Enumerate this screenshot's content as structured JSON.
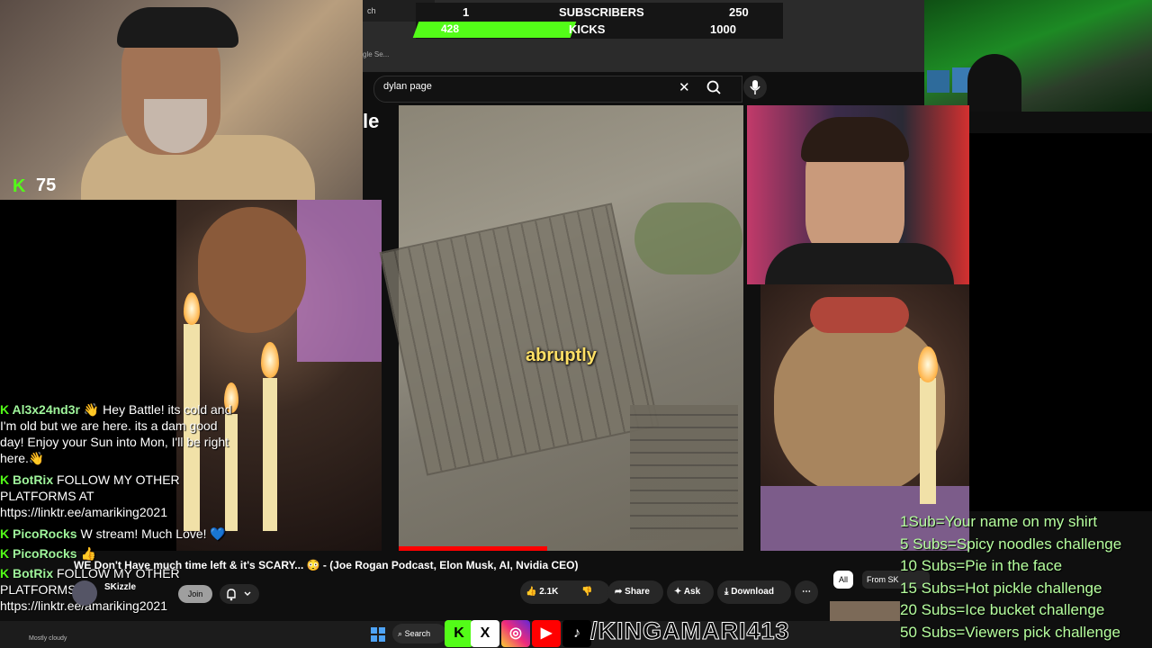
{
  "browser": {
    "tab_close": "×",
    "tab_plus": "+",
    "bookmark": "gle Se...",
    "search_value": "dylan page",
    "search_clear": "✕"
  },
  "goals_bar": {
    "subscribers_current": "1",
    "subscribers_label": "SUBSCRIBERS",
    "subscribers_target": "250",
    "kicks_current": "428",
    "kicks_label": "KICKS",
    "kicks_target": "1000",
    "kicks_progress": 0.428
  },
  "webcam": {
    "kick_viewers": "75"
  },
  "video": {
    "caption": "abruptly",
    "cut_letter": "le"
  },
  "chat": [
    {
      "user": "Al3x24nd3r",
      "message": "👋 Hey Battle! its cold and I'm old but we are here. its a dam good day! Enjoy your Sun into Mon, I'll be right here.👋"
    },
    {
      "user": "BotRix",
      "message": "FOLLOW MY OTHER PLATFORMS AT https://linktr.ee/amariking2021"
    },
    {
      "user": "PicoRocks",
      "message": "W stream! Much Love! 💙"
    },
    {
      "user": "PicoRocks",
      "message": "👍"
    },
    {
      "user": "BotRix",
      "message": "FOLLOW MY OTHER PLATFORMS AT https://linktr.ee/amariking2021"
    }
  ],
  "youtube": {
    "title": "WE Don't Have much time left & it's SCARY... 😳 - (Joe Rogan Podcast, Elon Musk, AI, Nvidia CEO)",
    "channel": "SKizzle",
    "join": "Join",
    "likes": "2.1K",
    "share": "Share",
    "ask": "Ask",
    "download": "Download",
    "more": "⋯",
    "chip_all": "All",
    "chip_from": "From SK"
  },
  "goal_list": [
    "1Sub=Your name on my shirt",
    "5 Subs=Spicy noodles challenge",
    "10 Subs=Pie in the face",
    "15 Subs=Hot pickle challenge",
    "20 Subs=Ice bucket challenge",
    "50 Subs=Viewers pick challenge"
  ],
  "taskbar": {
    "weather": "Mostly cloudy",
    "search": "Search",
    "handle": "/KINGAMARI413"
  },
  "colors": {
    "kick_green": "#53fc18",
    "goal_text": "#b6ff9e",
    "caption_yellow": "#ffe066"
  }
}
